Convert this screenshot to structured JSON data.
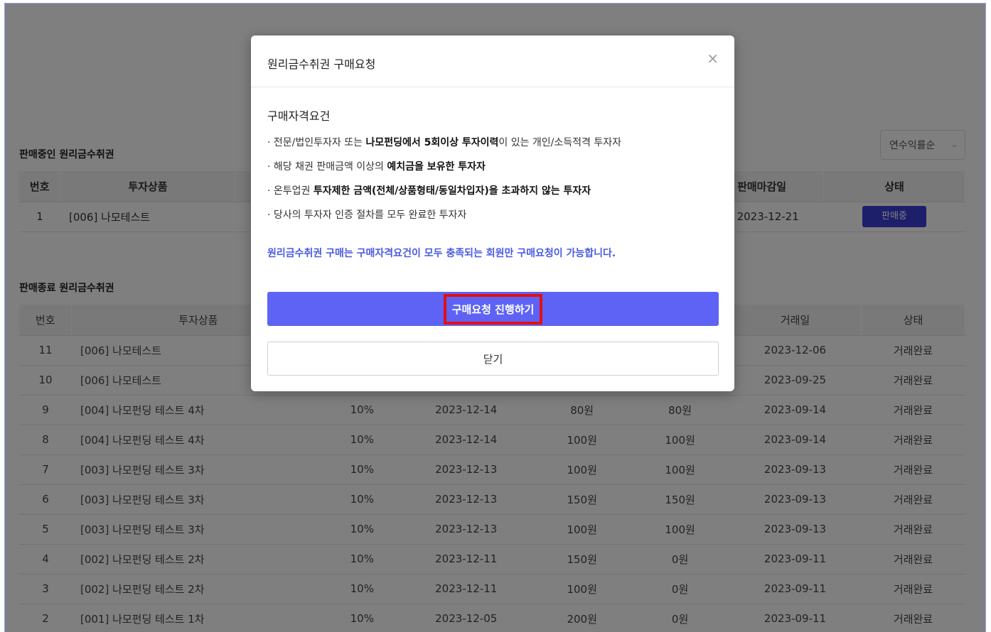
{
  "section_selling": "판매중인 원리금수취권",
  "section_ended": "판매종료 원리금수취권",
  "sort": {
    "selected": "연수익률순"
  },
  "table_selling": {
    "headers": [
      "번호",
      "투자상품",
      "판매마감일",
      "상태"
    ],
    "rows": [
      {
        "no": "1",
        "product": "[006] 나모테스트",
        "deadline": "2023-12-21",
        "status": "판매중"
      }
    ]
  },
  "table_ended": {
    "headers": [
      "번호",
      "투자상품",
      "거래일",
      "상태"
    ],
    "rows": [
      {
        "no": "11",
        "product": "[006] 나모테스트",
        "rate": "",
        "maturity": "",
        "price": "",
        "amount": "",
        "trade_date": "2023-12-06",
        "status": "거래완료"
      },
      {
        "no": "10",
        "product": "[006] 나모테스트",
        "rate": "",
        "maturity": "",
        "price": "",
        "amount": "",
        "trade_date": "2023-09-25",
        "status": "거래완료"
      },
      {
        "no": "9",
        "product": "[004] 나모펀딩 테스트 4차",
        "rate": "10%",
        "maturity": "2023-12-14",
        "price": "80원",
        "amount": "80원",
        "trade_date": "2023-09-14",
        "status": "거래완료"
      },
      {
        "no": "8",
        "product": "[004] 나모펀딩 테스트 4차",
        "rate": "10%",
        "maturity": "2023-12-14",
        "price": "100원",
        "amount": "100원",
        "trade_date": "2023-09-14",
        "status": "거래완료"
      },
      {
        "no": "7",
        "product": "[003] 나모펀딩 테스트 3차",
        "rate": "10%",
        "maturity": "2023-12-13",
        "price": "100원",
        "amount": "100원",
        "trade_date": "2023-09-13",
        "status": "거래완료"
      },
      {
        "no": "6",
        "product": "[003] 나모펀딩 테스트 3차",
        "rate": "10%",
        "maturity": "2023-12-13",
        "price": "150원",
        "amount": "150원",
        "trade_date": "2023-09-13",
        "status": "거래완료"
      },
      {
        "no": "5",
        "product": "[003] 나모펀딩 테스트 3차",
        "rate": "10%",
        "maturity": "2023-12-13",
        "price": "100원",
        "amount": "100원",
        "trade_date": "2023-09-13",
        "status": "거래완료"
      },
      {
        "no": "4",
        "product": "[002] 나모펀딩 테스트 2차",
        "rate": "10%",
        "maturity": "2023-12-11",
        "price": "150원",
        "amount": "0원",
        "trade_date": "2023-09-11",
        "status": "거래완료"
      },
      {
        "no": "3",
        "product": "[002] 나모펀딩 테스트 2차",
        "rate": "10%",
        "maturity": "2023-12-11",
        "price": "100원",
        "amount": "0원",
        "trade_date": "2023-09-11",
        "status": "거래완료"
      },
      {
        "no": "2",
        "product": "[001] 나모펀딩 테스트 1차",
        "rate": "10%",
        "maturity": "2023-12-05",
        "price": "200원",
        "amount": "0원",
        "trade_date": "2023-09-11",
        "status": "거래완료"
      }
    ]
  },
  "modal": {
    "title": "원리금수취권 구매요청",
    "close_icon": "×",
    "requirements_title": "구매자격요건",
    "requirements": [
      {
        "pre": "· 전문/법인투자자 또는 ",
        "bold": "나모펀딩에서 5회이상 투자이력",
        "post": "이 있는 개인/소득적격 투자자"
      },
      {
        "pre": "· 해당 채권 판매금액 이상의 ",
        "bold": "예치금을 보유한 투자자",
        "post": ""
      },
      {
        "pre": "· 온투업권 ",
        "bold": "투자제한 금액(전체/상품형태/동일차입자)을 초과하지 않는 투자자",
        "post": ""
      },
      {
        "pre": "· 당사의 투자자 인증 절차를 모두 완료한 투자자",
        "bold": "",
        "post": ""
      }
    ],
    "notice": "원리금수취권 구매는 구매자격요건이 모두 충족되는 회원만 구매요청이 가능합니다.",
    "proceed_label": "구매요청 진행하기",
    "close_label": "닫기"
  }
}
